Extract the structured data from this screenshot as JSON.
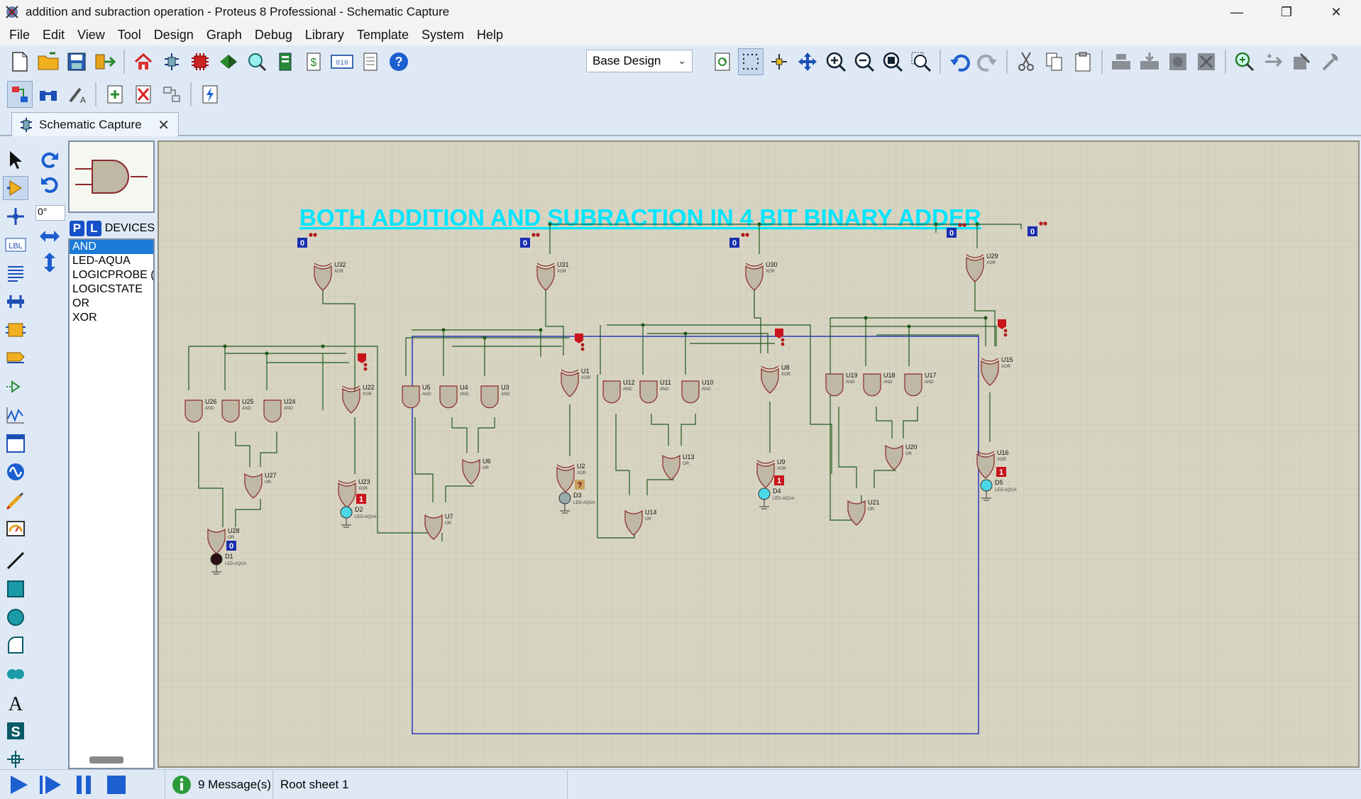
{
  "window": {
    "title": "addition and subraction operation  - Proteus 8 Professional - Schematic Capture",
    "minimize_glyph": "—",
    "maximize_glyph": "❐",
    "close_glyph": "✕"
  },
  "menu": [
    "File",
    "Edit",
    "View",
    "Tool",
    "Design",
    "Graph",
    "Debug",
    "Library",
    "Template",
    "System",
    "Help"
  ],
  "toolbar": {
    "design_select": "Base Design"
  },
  "tab": {
    "label": "Schematic Capture",
    "close_glyph": "✕"
  },
  "rotation": {
    "angle": "0°"
  },
  "devices": {
    "p_label": "P",
    "l_label": "L",
    "title": "DEVICES",
    "items": [
      "AND",
      "LED-AQUA",
      "LOGICPROBE (",
      "LOGICSTATE",
      "OR",
      "XOR"
    ],
    "selected_index": 0
  },
  "schematic": {
    "heading": "BOTH ADDITION AND SUBRACTION IN 4 BIT BINARY ADDER",
    "heading_color": "#00e5ff",
    "grid_bg": "#d8d4c2",
    "gate_fill": "#bfb8a4",
    "gate_stroke": "#8b2a2a",
    "wire_color": "#1d5a1d",
    "gates": [
      {
        "ref": "U32",
        "type": "XOR"
      },
      {
        "ref": "U31",
        "type": "XOR"
      },
      {
        "ref": "U30",
        "type": "XOR"
      },
      {
        "ref": "U29",
        "type": "XOR"
      },
      {
        "ref": "U22",
        "type": "XOR"
      },
      {
        "ref": "U23",
        "type": "XOR"
      },
      {
        "ref": "U1",
        "type": "XOR"
      },
      {
        "ref": "U2",
        "type": "XOR"
      },
      {
        "ref": "U8",
        "type": "XOR"
      },
      {
        "ref": "U9",
        "type": "XOR"
      },
      {
        "ref": "U15",
        "type": "XOR"
      },
      {
        "ref": "U16",
        "type": "XOR"
      },
      {
        "ref": "U26",
        "type": "AND"
      },
      {
        "ref": "U25",
        "type": "AND"
      },
      {
        "ref": "U24",
        "type": "AND"
      },
      {
        "ref": "U5",
        "type": "AND"
      },
      {
        "ref": "U4",
        "type": "AND"
      },
      {
        "ref": "U3",
        "type": "AND"
      },
      {
        "ref": "U12",
        "type": "AND"
      },
      {
        "ref": "U11",
        "type": "AND"
      },
      {
        "ref": "U10",
        "type": "AND"
      },
      {
        "ref": "U19",
        "type": "AND"
      },
      {
        "ref": "U18",
        "type": "AND"
      },
      {
        "ref": "U17",
        "type": "AND"
      },
      {
        "ref": "U27",
        "type": "OR"
      },
      {
        "ref": "U28",
        "type": "OR"
      },
      {
        "ref": "U6",
        "type": "OR"
      },
      {
        "ref": "U7",
        "type": "OR"
      },
      {
        "ref": "U13",
        "type": "OR"
      },
      {
        "ref": "U14",
        "type": "OR"
      },
      {
        "ref": "U20",
        "type": "OR"
      },
      {
        "ref": "U21",
        "type": "OR"
      }
    ],
    "leds": [
      {
        "ref": "D1",
        "part": "LED-AQUA",
        "state": "0"
      },
      {
        "ref": "D2",
        "part": "LED-AQUA",
        "state": "1"
      },
      {
        "ref": "D3",
        "part": "LED-AQUA",
        "state": "?"
      },
      {
        "ref": "D4",
        "part": "LED-AQUA",
        "state": "1"
      },
      {
        "ref": "D5",
        "part": "LED-AQUA",
        "state": "1"
      }
    ],
    "logic_states": [
      "0",
      "0",
      "0",
      "0",
      "0"
    ]
  },
  "status": {
    "messages": "9 Message(s)",
    "sheet": "Root sheet 1"
  }
}
